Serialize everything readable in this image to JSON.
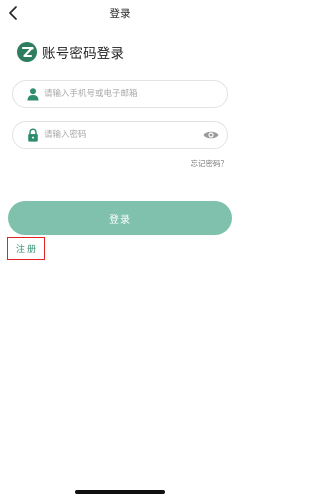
{
  "nav": {
    "title": "登录"
  },
  "brand": {
    "heading": "账号密码登录",
    "logo_icon": "z-logo-icon"
  },
  "account_field": {
    "placeholder": "请输入手机号或电子邮箱",
    "value": "",
    "icon": "user-icon"
  },
  "password_field": {
    "placeholder": "请输入密码",
    "value": "",
    "icon": "lock-icon",
    "toggle_icon": "eye-icon"
  },
  "forgot_password": "忘记密码？",
  "login_button": "登录",
  "register_link": "注册",
  "colors": {
    "accent": "#2f8c6f",
    "button": "#7fc1ac",
    "highlight_border": "#e32222"
  }
}
